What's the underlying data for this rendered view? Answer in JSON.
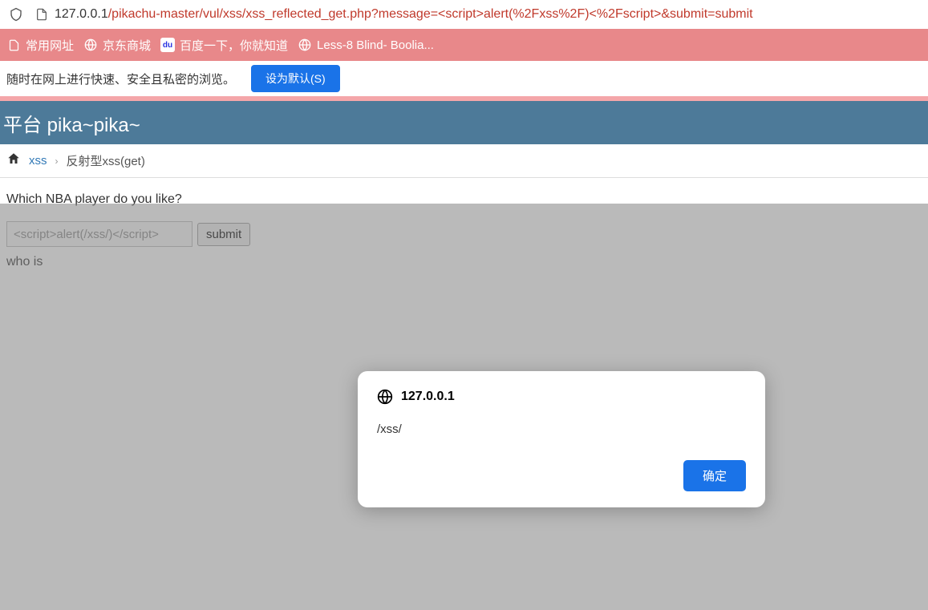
{
  "url": {
    "host": "127.0.0.1",
    "path": "/pikachu-master/vul/xss/xss_reflected_get.php?message=<script>alert(%2Fxss%2F)<%2Fscript>&submit=submit"
  },
  "bookmarks": {
    "items": [
      {
        "label": "常用网址"
      },
      {
        "label": "京东商城"
      },
      {
        "label": "百度一下，你就知道"
      },
      {
        "label": "Less-8 Blind- Boolia..."
      }
    ]
  },
  "infobar": {
    "text": "随时在网上进行快速、安全且私密的浏览。",
    "button": "设为默认(S)"
  },
  "header": {
    "title": "平台 pika~pika~"
  },
  "breadcrumb": {
    "link": "xss",
    "current": "反射型xss(get)"
  },
  "page": {
    "question": "Which NBA player do you like?",
    "input_value": "<script>alert(/xss/)</script>",
    "submit_label": "submit",
    "result": "who is"
  },
  "alert": {
    "host": "127.0.0.1",
    "message": "/xss/",
    "ok": "确定"
  }
}
